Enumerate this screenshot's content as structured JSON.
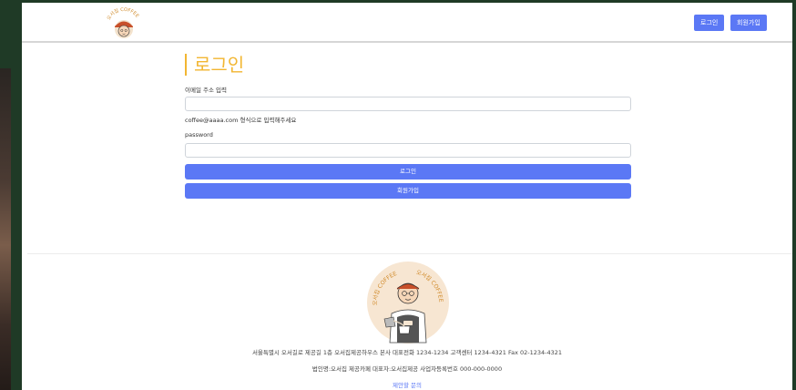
{
  "header": {
    "logo_text": "오서집 COFFEE",
    "login_button": "로그인",
    "signup_button": "회원가입"
  },
  "form": {
    "title": "로그인",
    "email_label": "이메일 주소 입력",
    "email_value": "",
    "email_helper": "coffee@aaaa.com 형식으로 입력해주세요",
    "password_label": "password",
    "password_value": "",
    "login_button": "로그인",
    "signup_button": "회원가입"
  },
  "footer": {
    "logo_text": "오서집 COFFEE",
    "address": "서울특별시 오서길로 제공길 1층 오서집제공하우스 본사 대표전화 1234-1234 고객센터 1234-4321 Fax 02-1234-4321",
    "company": "법인명:오서집 제공카페 대표자:오서집제공 사업자등록번호 000-000-0000",
    "link": "제안할 문의"
  },
  "colors": {
    "accent": "#5b78f5",
    "title": "#f2b632",
    "frame_bg": "#1f3a26"
  }
}
